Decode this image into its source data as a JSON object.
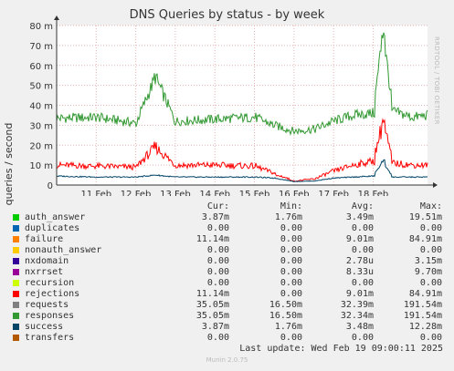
{
  "title": "DNS Queries by status - by week",
  "watermark": "RRDTOOL / TOBI OETIKER",
  "chart_data": {
    "type": "line",
    "title": "DNS Queries by status - by week",
    "ylabel": "queries / second",
    "xlabel": "",
    "ylim": [
      0,
      80
    ],
    "y_unit": "m",
    "y_ticks": [
      "0",
      "10 m",
      "20 m",
      "30 m",
      "40 m",
      "50 m",
      "60 m",
      "70 m",
      "80 m"
    ],
    "x_ticks": [
      "11 Feb",
      "12 Feb",
      "13 Feb",
      "14 Feb",
      "15 Feb",
      "16 Feb",
      "17 Feb",
      "18 Feb"
    ],
    "grid": true,
    "x": [
      "10 Feb",
      "11 Feb",
      "12 Feb",
      "12 Feb 12:00",
      "13 Feb",
      "14 Feb",
      "15 Feb",
      "15 Feb 12:00",
      "16 Feb",
      "16 Feb 12:00",
      "17 Feb",
      "17 Feb 12:00",
      "18 Feb",
      "18 Feb 06:00",
      "18 Feb 12:00",
      "19 Feb",
      "19 Feb 09:00"
    ],
    "series": [
      {
        "name": "requests",
        "color": "#339933",
        "values": [
          33.5,
          34,
          31,
          54,
          32,
          33,
          34,
          30,
          27,
          28,
          32,
          35,
          36,
          77,
          37,
          34,
          35
        ]
      },
      {
        "name": "rejections",
        "color": "#ff0000",
        "values": [
          10,
          9.5,
          9,
          19,
          10,
          10,
          9.5,
          6,
          2,
          3,
          7,
          10,
          12,
          32,
          11,
          10,
          10
        ]
      },
      {
        "name": "success",
        "color": "#004466",
        "values": [
          4.5,
          4,
          4,
          5,
          4,
          4,
          4,
          3.5,
          1.8,
          2,
          3.5,
          4,
          4.5,
          12,
          4,
          4,
          4
        ]
      },
      {
        "name": "nxrrset",
        "color": "#990099",
        "values": [
          0,
          0,
          0,
          0,
          0,
          0,
          0,
          0,
          0,
          0,
          0,
          0,
          0,
          0,
          0,
          0,
          0
        ]
      }
    ]
  },
  "legend": {
    "headers": [
      "Cur:",
      "Min:",
      "Avg:",
      "Max:"
    ],
    "rows": [
      {
        "name": "auth_answer",
        "color": "#00cc00",
        "cur": "3.87m",
        "min": "1.76m",
        "avg": "3.49m",
        "max": "19.51m"
      },
      {
        "name": "duplicates",
        "color": "#0066b3",
        "cur": "0.00",
        "min": "0.00",
        "avg": "0.00",
        "max": "0.00"
      },
      {
        "name": "failure",
        "color": "#ff8000",
        "cur": "11.14m",
        "min": "0.00",
        "avg": "9.01m",
        "max": "84.91m"
      },
      {
        "name": "nonauth_answer",
        "color": "#ffcc00",
        "cur": "0.00",
        "min": "0.00",
        "avg": "0.00",
        "max": "0.00"
      },
      {
        "name": "nxdomain",
        "color": "#330099",
        "cur": "0.00",
        "min": "0.00",
        "avg": "2.78u",
        "max": "3.15m"
      },
      {
        "name": "nxrrset",
        "color": "#990099",
        "cur": "0.00",
        "min": "0.00",
        "avg": "8.33u",
        "max": "9.70m"
      },
      {
        "name": "recursion",
        "color": "#ccff00",
        "cur": "0.00",
        "min": "0.00",
        "avg": "0.00",
        "max": "0.00"
      },
      {
        "name": "rejections",
        "color": "#ff0000",
        "cur": "11.14m",
        "min": "0.00",
        "avg": "9.01m",
        "max": "84.91m"
      },
      {
        "name": "requests",
        "color": "#808080",
        "cur": "35.05m",
        "min": "16.50m",
        "avg": "32.39m",
        "max": "191.54m"
      },
      {
        "name": "responses",
        "color": "#339933",
        "cur": "35.05m",
        "min": "16.50m",
        "avg": "32.34m",
        "max": "191.54m"
      },
      {
        "name": "success",
        "color": "#004466",
        "cur": "3.87m",
        "min": "1.76m",
        "avg": "3.48m",
        "max": "12.28m"
      },
      {
        "name": "transfers",
        "color": "#b35a00",
        "cur": "0.00",
        "min": "0.00",
        "avg": "0.00",
        "max": "0.00"
      }
    ]
  },
  "last_update": "Last update: Wed Feb 19 09:00:11 2025",
  "version": "Munin 2.0.75"
}
